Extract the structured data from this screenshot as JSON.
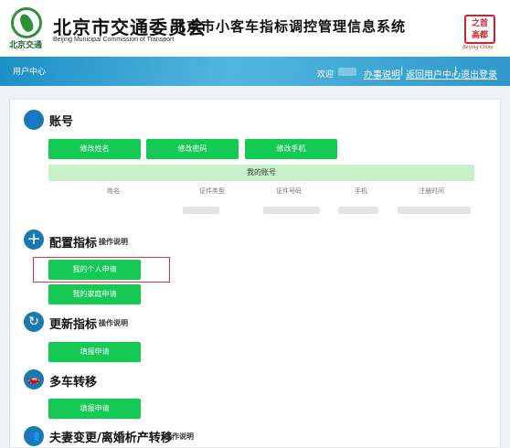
{
  "header": {
    "logo_caption": "北京交通",
    "org_title": "北京市交通委员会",
    "org_subtitle": "Beijing Municipal Commission of Transport",
    "system_title": "北京市小客车指标调控管理信息系统",
    "seal_text": "之首 高都",
    "seal_caption": "Beijing China"
  },
  "navbar": {
    "user_center": "用户中心",
    "welcome": "欢迎",
    "links": [
      "办事说明",
      "返回用户中心",
      "退出登录"
    ]
  },
  "account": {
    "title": "账号",
    "buttons": [
      "修改姓名",
      "修改密码",
      "修改手机"
    ],
    "my_account": "我的账号",
    "columns": [
      "姓名",
      "证件类型",
      "证件号码",
      "手机",
      "注册时间"
    ]
  },
  "config": {
    "title": "配置指标",
    "hint": "操作说明",
    "buttons": [
      "我的个人申请",
      "我的家庭申请"
    ]
  },
  "renew": {
    "title": "更新指标",
    "hint": "操作说明",
    "button": "填报申请"
  },
  "transfer": {
    "title": "多车转移",
    "button": "填报申请"
  },
  "divorce": {
    "title": "夫妻变更/离婚析产转移",
    "hint": "操作说明"
  },
  "colors": {
    "nav_blue": "#2f98c9",
    "button_green": "#14c954",
    "icon_blue": "#1a7ab0",
    "highlight_red": "#d8383d"
  }
}
